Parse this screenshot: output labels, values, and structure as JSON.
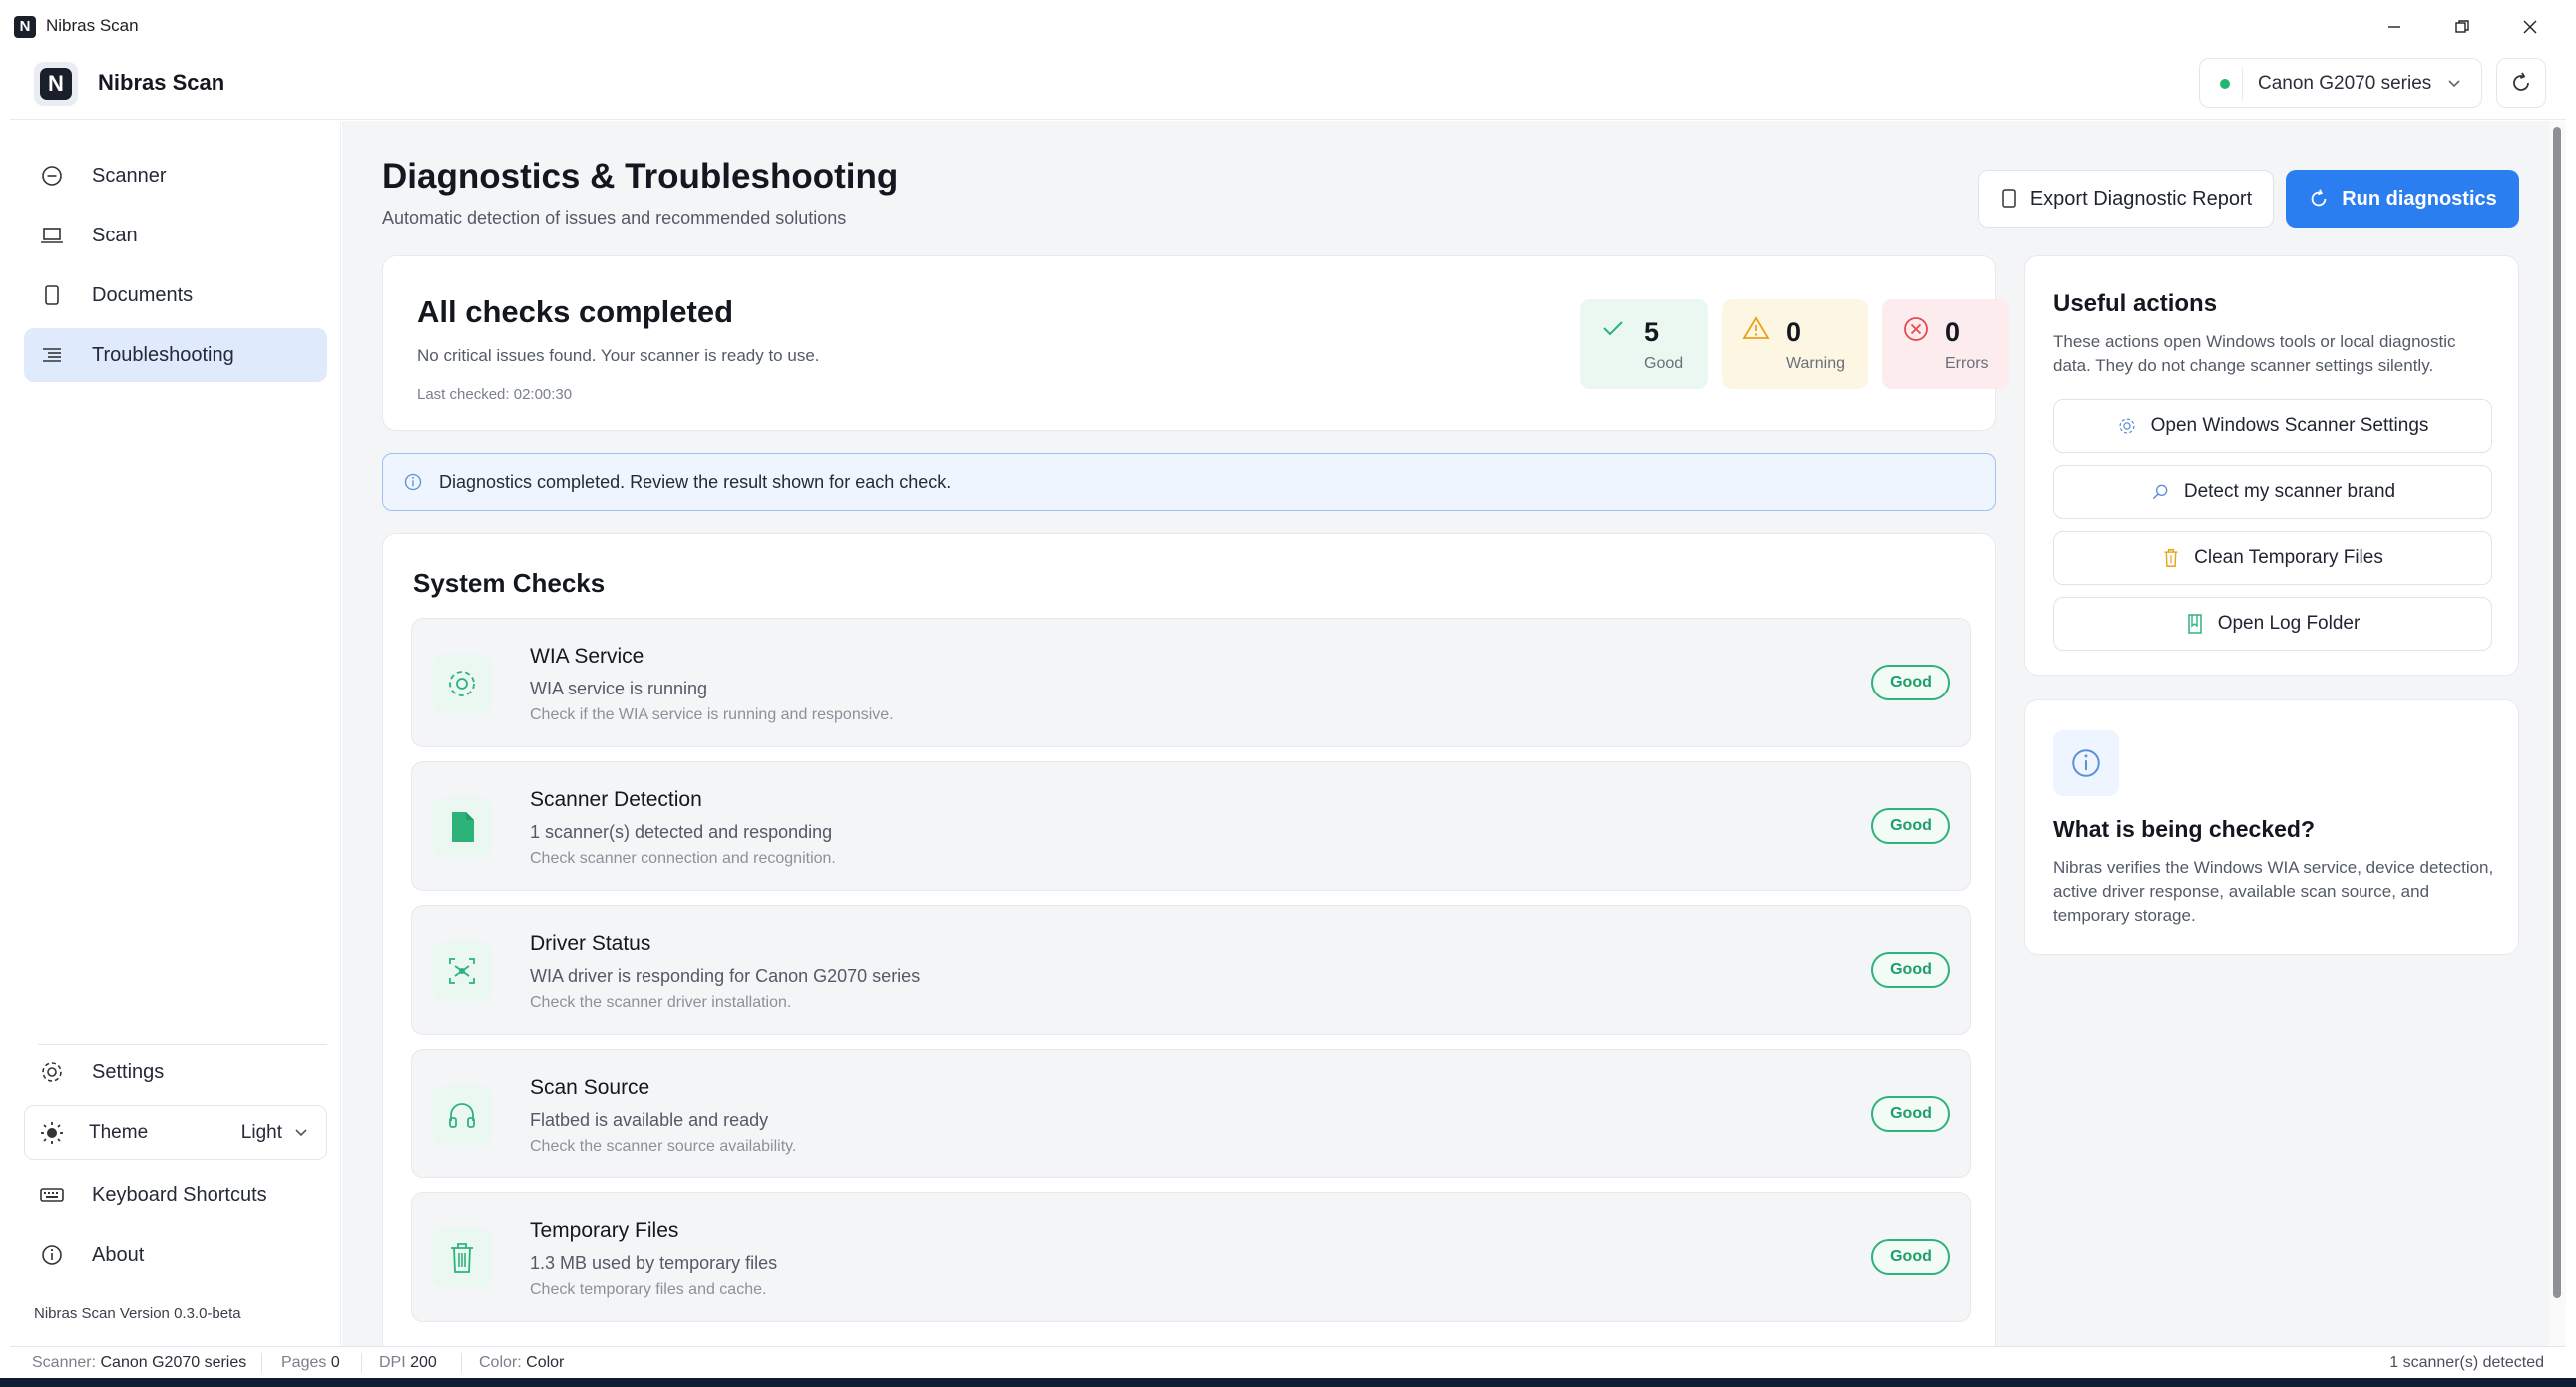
{
  "window": {
    "title": "Nibras Scan"
  },
  "app": {
    "brand": "Nibras Scan",
    "logo_letter": "N",
    "selected_scanner": "Canon G2070 series"
  },
  "sidebar": {
    "items": [
      {
        "label": "Scanner"
      },
      {
        "label": "Scan"
      },
      {
        "label": "Documents"
      },
      {
        "label": "Troubleshooting"
      }
    ],
    "settings": "Settings",
    "theme_label": "Theme",
    "theme_value": "Light",
    "keyboard_shortcuts": "Keyboard Shortcuts",
    "about": "About",
    "version": "Nibras Scan Version 0.3.0-beta"
  },
  "page": {
    "title": "Diagnostics & Troubleshooting",
    "subtitle": "Automatic detection of issues and recommended solutions",
    "export_button": "Export Diagnostic Report",
    "run_button": "Run diagnostics"
  },
  "summary": {
    "title": "All checks completed",
    "message": "No critical issues found. Your scanner is ready to use.",
    "last_checked": "Last checked: 02:00:30",
    "good_count": "5",
    "good_label": "Good",
    "warning_count": "0",
    "warning_label": "Warning",
    "error_count": "0",
    "error_label": "Errors"
  },
  "banner": {
    "text": "Diagnostics completed. Review the result shown for each check."
  },
  "checks": {
    "title": "System Checks",
    "items": [
      {
        "name": "WIA Service",
        "status": "WIA service is running",
        "desc": "Check if the WIA service is running and responsive.",
        "badge": "Good"
      },
      {
        "name": "Scanner Detection",
        "status": "1 scanner(s) detected and responding",
        "desc": "Check scanner connection and recognition.",
        "badge": "Good"
      },
      {
        "name": "Driver Status",
        "status": "WIA driver is responding for Canon G2070 series",
        "desc": "Check the scanner driver installation.",
        "badge": "Good"
      },
      {
        "name": "Scan Source",
        "status": "Flatbed is available and ready",
        "desc": "Check the scanner source availability.",
        "badge": "Good"
      },
      {
        "name": "Temporary Files",
        "status": "1.3 MB used by temporary files",
        "desc": "Check temporary files and cache.",
        "badge": "Good"
      }
    ]
  },
  "actions": {
    "title": "Useful actions",
    "desc": "These actions open Windows tools or local diagnostic data. They do not change scanner settings silently.",
    "buttons": [
      {
        "label": "Open Windows Scanner Settings"
      },
      {
        "label": "Detect my scanner brand"
      },
      {
        "label": "Clean Temporary Files"
      },
      {
        "label": "Open Log Folder"
      }
    ]
  },
  "info": {
    "title": "What is being checked?",
    "desc": "Nibras verifies the Windows WIA service, device detection, active driver response, available scan source, and temporary storage."
  },
  "statusbar": {
    "scanner_key": "Scanner:",
    "scanner_val": "Canon G2070 series",
    "pages_key": "Pages",
    "pages_val": "0",
    "dpi_key": "DPI",
    "dpi_val": "200",
    "color_key": "Color:",
    "color_val": "Color",
    "detected": "1 scanner(s) detected"
  },
  "colors": {
    "accent": "#2b7ef0",
    "good": "#2db37a",
    "warning": "#e8a317",
    "error": "#e5484d"
  }
}
